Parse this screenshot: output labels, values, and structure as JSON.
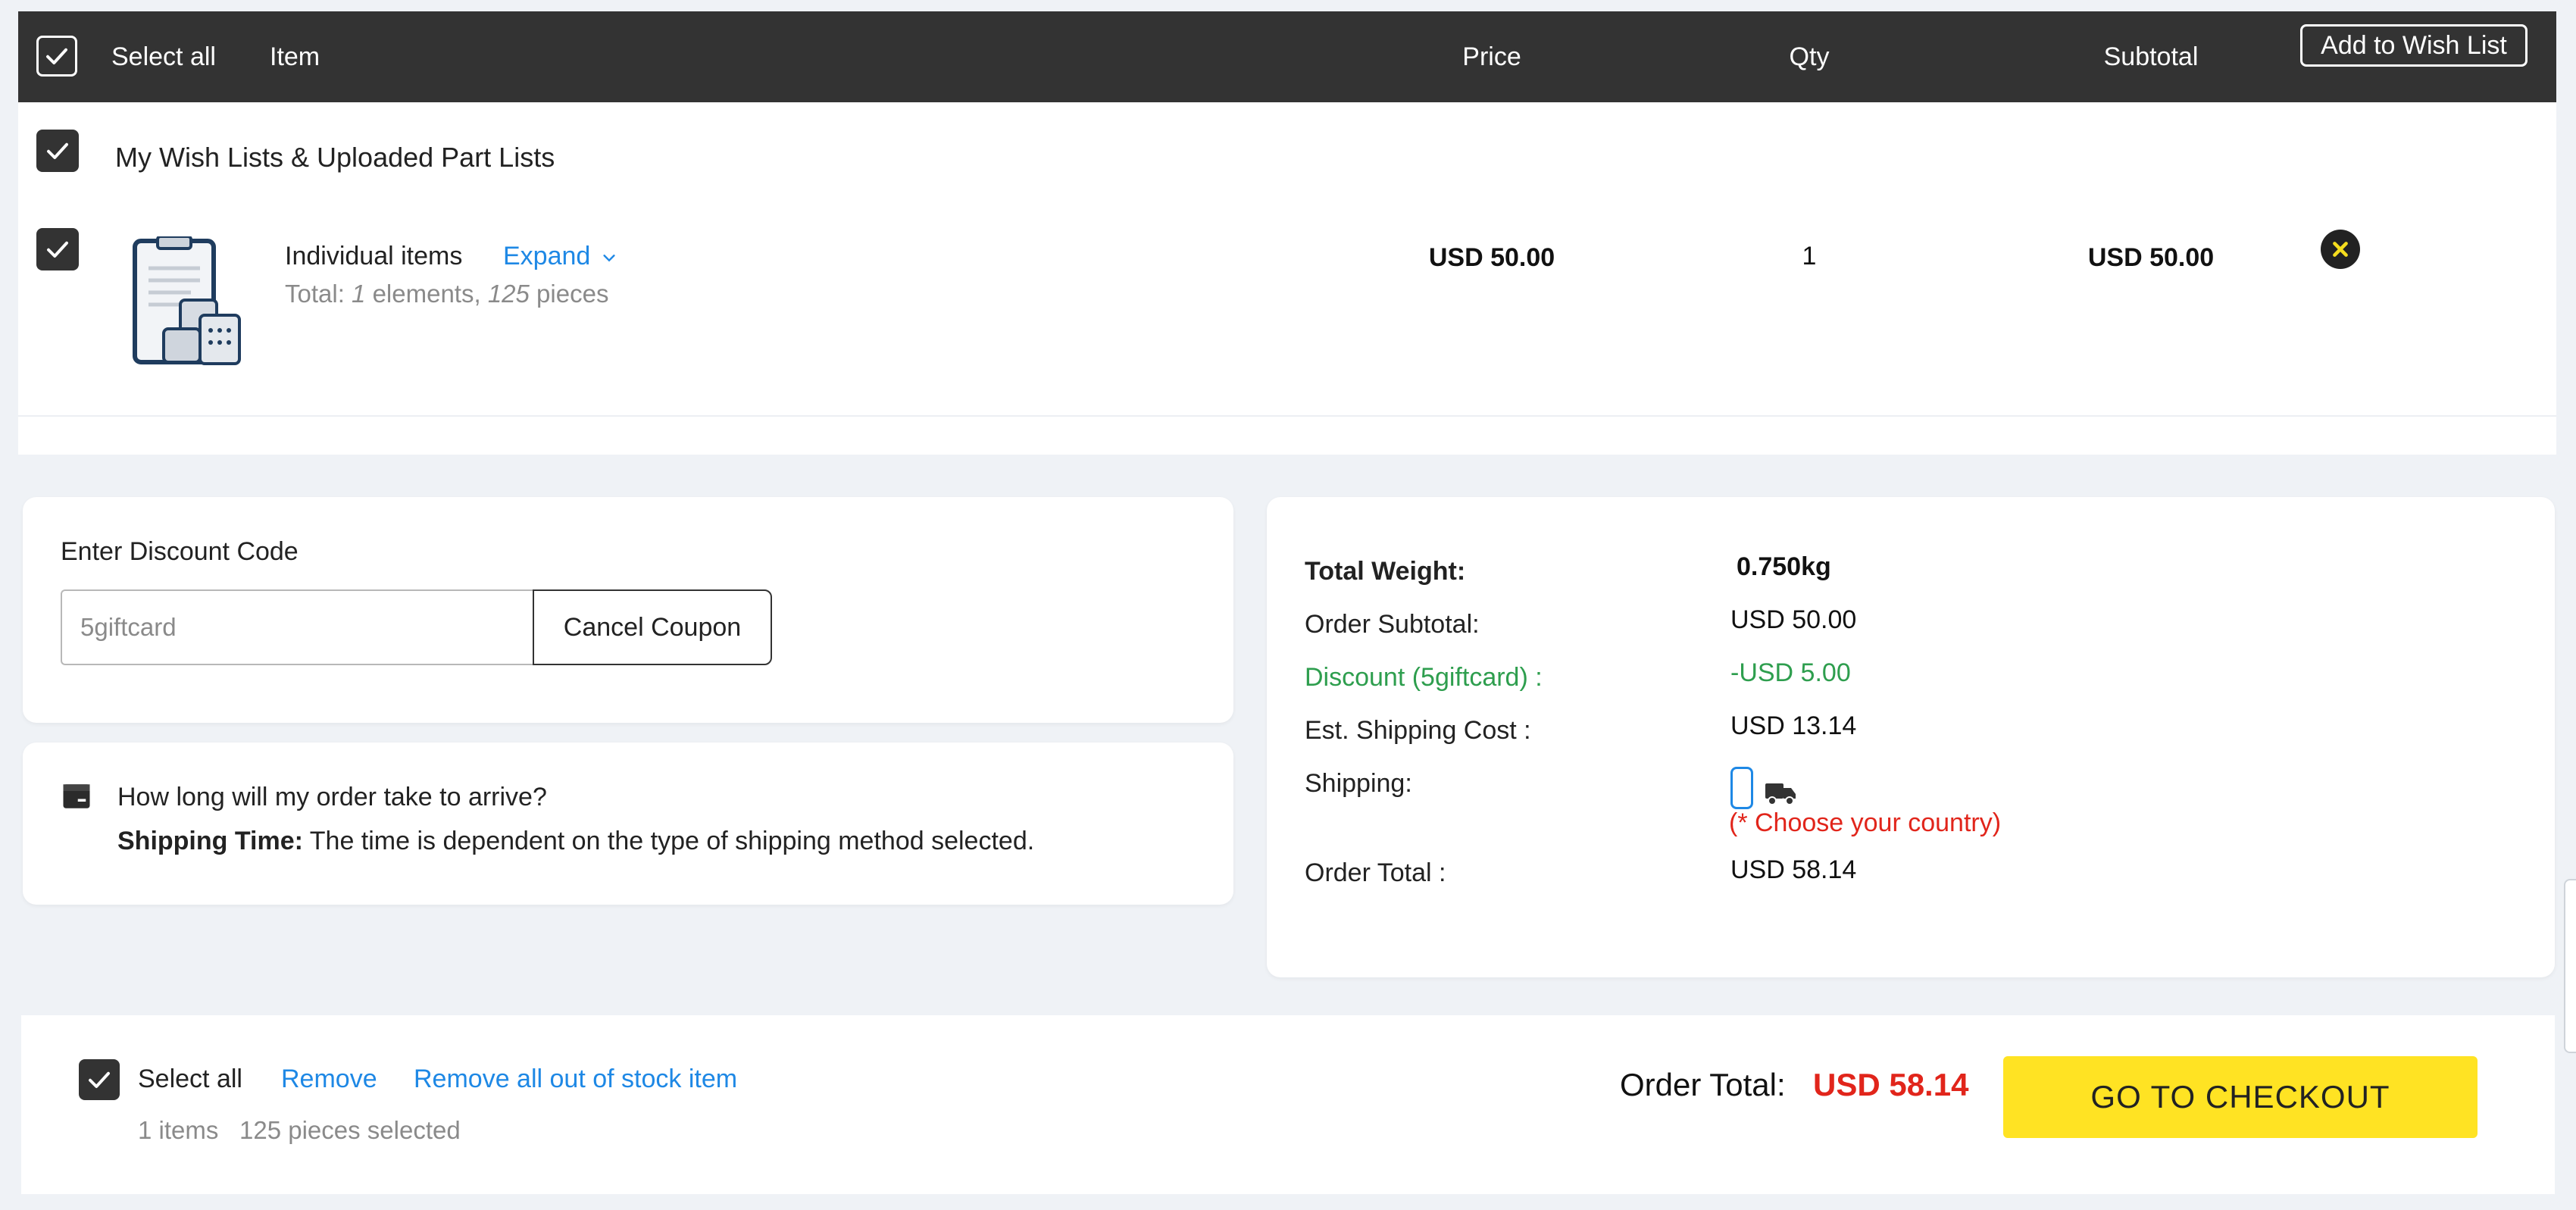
{
  "header": {
    "select_all": "Select all",
    "item": "Item",
    "price": "Price",
    "qty": "Qty",
    "subtotal": "Subtotal",
    "add_to_wish_list": "Add to Wish List"
  },
  "group": {
    "title": "My Wish Lists & Uploaded Part Lists"
  },
  "item": {
    "name": "Individual items",
    "expand": "Expand",
    "total_prefix": "Total: ",
    "elements_count": "1",
    "elements_label": " elements, ",
    "pieces_count": "125",
    "pieces_label": " pieces",
    "price": "USD 50.00",
    "qty": "1",
    "subtotal": "USD 50.00",
    "icon": "clipboard-parts-icon"
  },
  "discount": {
    "label": "Enter Discount Code",
    "code_value": "5giftcard",
    "cancel_button": "Cancel Coupon"
  },
  "shipping_info": {
    "question": "How long will my order take to arrive?",
    "time_label": "Shipping Time:",
    "time_text": " The time is dependent on the type of shipping method selected."
  },
  "summary": {
    "total_weight_label": "Total Weight:",
    "total_weight_value": "0.750kg",
    "order_subtotal_label": "Order Subtotal:",
    "order_subtotal_value": "USD 50.00",
    "discount_label": "Discount (5giftcard) :",
    "discount_value": "-USD 5.00",
    "est_shipping_label": "Est. Shipping Cost :",
    "est_shipping_value": "USD 13.14",
    "shipping_label": "Shipping:",
    "choose_country": "(* Choose your country)",
    "order_total_label": "Order Total :",
    "order_total_value": "USD 58.14"
  },
  "bottom": {
    "select_all": "Select all",
    "remove": "Remove",
    "remove_out_of_stock": "Remove all out of stock item",
    "items_count": "1 items",
    "pieces_selected": "125 pieces selected",
    "order_total_label": "Order Total:",
    "order_total_value": "USD 58.14",
    "checkout": "GO TO CHECKOUT"
  },
  "colors": {
    "header_bg": "#333333",
    "link": "#1e88e5",
    "discount_green": "#2e9e4e",
    "alert_red": "#e1251b",
    "checkout_yellow": "#ffe323",
    "remove_icon": "#f5dd1e"
  }
}
